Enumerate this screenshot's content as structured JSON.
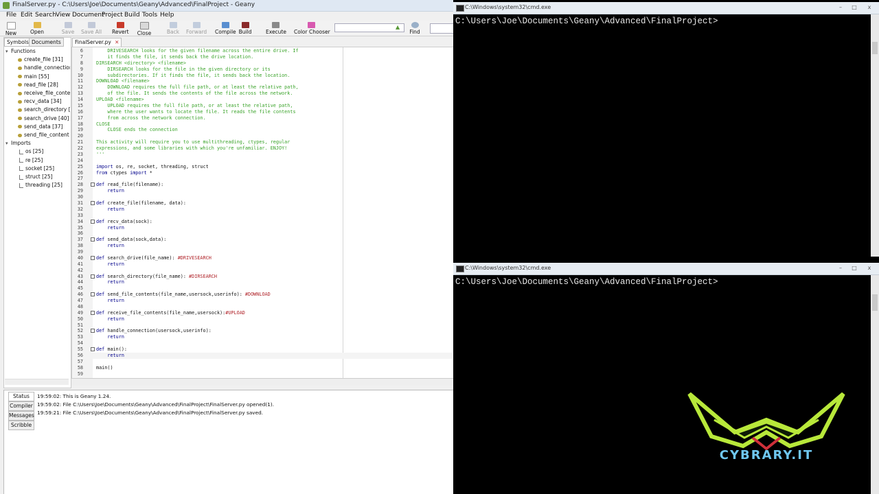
{
  "geany": {
    "title": "FinalServer.py - C:\\Users\\Joe\\Documents\\Geany\\Advanced\\FinalProject - Geany",
    "menu": [
      "File",
      "Edit",
      "Search",
      "View",
      "Document",
      "Project",
      "Build",
      "Tools",
      "Help"
    ],
    "toolbar": {
      "new": "New",
      "open": "Open",
      "save": "Save",
      "save_all": "Save All",
      "revert": "Revert",
      "close": "Close",
      "back": "Back",
      "forward": "Forward",
      "compile": "Compile",
      "build": "Build",
      "execute": "Execute",
      "color_chooser": "Color Chooser",
      "find": "Find"
    },
    "sidebar": {
      "tabs": [
        "Symbols",
        "Documents"
      ],
      "functions_label": "Functions",
      "functions": [
        "create_file [31]",
        "handle_connection",
        "main [55]",
        "read_file [28]",
        "receive_file_conte",
        "recv_data [34]",
        "search_directory [",
        "search_drive [40]",
        "send_data [37]",
        "send_file_content"
      ],
      "imports_label": "Imports",
      "imports": [
        "os [25]",
        "re [25]",
        "socket [25]",
        "struct [25]",
        "threading [25]"
      ]
    },
    "editor_tab": "FinalServer.py",
    "code": [
      {
        "n": "6",
        "segs": [
          [
            "com",
            "    DRIVESEARCH looks for the given filename across the entire drive. If"
          ]
        ]
      },
      {
        "n": "7",
        "segs": [
          [
            "com",
            "    it finds the file, it sends back the drive location."
          ]
        ]
      },
      {
        "n": "8",
        "segs": [
          [
            "com",
            "DIRSEARCH <directory> <filename>"
          ]
        ]
      },
      {
        "n": "9",
        "segs": [
          [
            "com",
            "    DIRSEARCH looks for the file in the given directory or its"
          ]
        ]
      },
      {
        "n": "10",
        "segs": [
          [
            "com",
            "    subdirectories. If it finds the file, it sends back the location."
          ]
        ]
      },
      {
        "n": "11",
        "segs": [
          [
            "com",
            "DOWNLOAD <filename>"
          ]
        ]
      },
      {
        "n": "12",
        "segs": [
          [
            "com",
            "    DOWNLOAD requires the full file path, or at least the relative path,"
          ]
        ]
      },
      {
        "n": "13",
        "segs": [
          [
            "com",
            "    of the file. It sends the contents of the file across the network."
          ]
        ]
      },
      {
        "n": "14",
        "segs": [
          [
            "com",
            "UPLOAD <filename>"
          ]
        ]
      },
      {
        "n": "15",
        "segs": [
          [
            "com",
            "    UPLOAD requires the full file path, or at least the relative path,"
          ]
        ]
      },
      {
        "n": "16",
        "segs": [
          [
            "com",
            "    where the user wants to locate the file. It reads the file contents"
          ]
        ]
      },
      {
        "n": "17",
        "segs": [
          [
            "com",
            "    from across the network connection."
          ]
        ]
      },
      {
        "n": "18",
        "segs": [
          [
            "com",
            "CLOSE"
          ]
        ]
      },
      {
        "n": "19",
        "segs": [
          [
            "com",
            "    CLOSE ends the connection"
          ]
        ]
      },
      {
        "n": "20",
        "segs": []
      },
      {
        "n": "21",
        "segs": [
          [
            "com",
            "This activity will require you to use multithreading, ctypes, regular"
          ]
        ]
      },
      {
        "n": "22",
        "segs": [
          [
            "com",
            "expressions, and some libraries with which you're unfamiliar. ENJOY!"
          ]
        ]
      },
      {
        "n": "23",
        "segs": [
          [
            "com",
            "'''"
          ]
        ]
      },
      {
        "n": "24",
        "segs": []
      },
      {
        "n": "25",
        "segs": [
          [
            "kw",
            "import"
          ],
          [
            "txt",
            " os, re, socket, threading, struct"
          ]
        ]
      },
      {
        "n": "26",
        "segs": [
          [
            "kw",
            "from"
          ],
          [
            "txt",
            " ctypes "
          ],
          [
            "kw",
            "import"
          ],
          [
            "txt",
            " *"
          ]
        ]
      },
      {
        "n": "27",
        "segs": []
      },
      {
        "n": "28",
        "fold": true,
        "segs": [
          [
            "kw",
            "def"
          ],
          [
            "txt",
            " read_file(filename):"
          ]
        ]
      },
      {
        "n": "29",
        "segs": [
          [
            "kw",
            "    return"
          ]
        ]
      },
      {
        "n": "30",
        "segs": []
      },
      {
        "n": "31",
        "fold": true,
        "segs": [
          [
            "kw",
            "def"
          ],
          [
            "txt",
            " create_file(filename, data):"
          ]
        ]
      },
      {
        "n": "32",
        "segs": [
          [
            "kw",
            "    return"
          ]
        ]
      },
      {
        "n": "33",
        "segs": []
      },
      {
        "n": "34",
        "fold": true,
        "segs": [
          [
            "kw",
            "def"
          ],
          [
            "txt",
            " recv_data(sock):"
          ]
        ]
      },
      {
        "n": "35",
        "segs": [
          [
            "kw",
            "    return"
          ]
        ]
      },
      {
        "n": "36",
        "segs": []
      },
      {
        "n": "37",
        "fold": true,
        "segs": [
          [
            "kw",
            "def"
          ],
          [
            "txt",
            " send_data(sock,data):"
          ]
        ]
      },
      {
        "n": "38",
        "segs": [
          [
            "kw",
            "    return"
          ]
        ]
      },
      {
        "n": "39",
        "segs": []
      },
      {
        "n": "40",
        "fold": true,
        "segs": [
          [
            "kw",
            "def"
          ],
          [
            "txt",
            " search_drive(file_name): "
          ],
          [
            "tag",
            "#DRIVESEARCH"
          ]
        ]
      },
      {
        "n": "41",
        "segs": [
          [
            "kw",
            "    return"
          ]
        ]
      },
      {
        "n": "42",
        "segs": []
      },
      {
        "n": "43",
        "fold": true,
        "segs": [
          [
            "kw",
            "def"
          ],
          [
            "txt",
            " search_directory(file_name): "
          ],
          [
            "tag",
            "#DIRSEARCH"
          ]
        ]
      },
      {
        "n": "44",
        "segs": [
          [
            "kw",
            "    return"
          ]
        ]
      },
      {
        "n": "45",
        "segs": []
      },
      {
        "n": "46",
        "fold": true,
        "segs": [
          [
            "kw",
            "def"
          ],
          [
            "txt",
            " send_file_contents(file_name,usersock,userinfo): "
          ],
          [
            "tag",
            "#DOWNLOAD"
          ]
        ]
      },
      {
        "n": "47",
        "segs": [
          [
            "kw",
            "    return"
          ]
        ]
      },
      {
        "n": "48",
        "segs": []
      },
      {
        "n": "49",
        "fold": true,
        "segs": [
          [
            "kw",
            "def"
          ],
          [
            "txt",
            " receive_file_contents(file_name,usersock):"
          ],
          [
            "tag",
            "#UPLOAD"
          ]
        ]
      },
      {
        "n": "50",
        "segs": [
          [
            "kw",
            "    return"
          ]
        ]
      },
      {
        "n": "51",
        "segs": []
      },
      {
        "n": "52",
        "fold": true,
        "segs": [
          [
            "kw",
            "def"
          ],
          [
            "txt",
            " handle_connection(usersock,userinfo):"
          ]
        ]
      },
      {
        "n": "53",
        "segs": [
          [
            "kw",
            "    return"
          ]
        ]
      },
      {
        "n": "54",
        "segs": []
      },
      {
        "n": "55",
        "fold": true,
        "segs": [
          [
            "kw",
            "def"
          ],
          [
            "txt",
            " main():"
          ]
        ]
      },
      {
        "n": "56",
        "current": true,
        "segs": [
          [
            "kw",
            "    return"
          ]
        ]
      },
      {
        "n": "57",
        "segs": []
      },
      {
        "n": "58",
        "segs": [
          [
            "txt",
            "main()"
          ]
        ]
      },
      {
        "n": "59",
        "segs": []
      }
    ],
    "message_tabs": [
      "Status",
      "Compiler",
      "Messages",
      "Scribble"
    ],
    "messages": [
      "19:59:02: This is Geany 1.24.",
      "19:59:02: File C:\\Users\\Joe\\Documents\\Geany\\Advanced\\FinalProject\\FinalServer.py opened(1).",
      "19:59:21: File C:\\Users\\Joe\\Documents\\Geany\\Advanced\\FinalProject\\FinalServer.py saved."
    ]
  },
  "cmd_top": {
    "title": "C:\\Windows\\system32\\cmd.exe",
    "prompt": "C:\\Users\\Joe\\Documents\\Geany\\Advanced\\FinalProject>"
  },
  "cmd_bottom": {
    "title": "C:\\Windows\\system32\\cmd.exe",
    "prompt": "C:\\Users\\Joe\\Documents\\Geany\\Advanced\\FinalProject>"
  },
  "window_buttons": {
    "minimize": "–",
    "maximize": "□",
    "close": "x"
  },
  "watermark": {
    "text": "CYBRARY.IT",
    "colors": {
      "lime": "#b8e83a",
      "blue": "#6fc7ef",
      "red": "#d0303a"
    }
  },
  "colors": {
    "comment": "#3aa32a",
    "keyword": "#00008b",
    "tag": "#b0242a"
  }
}
